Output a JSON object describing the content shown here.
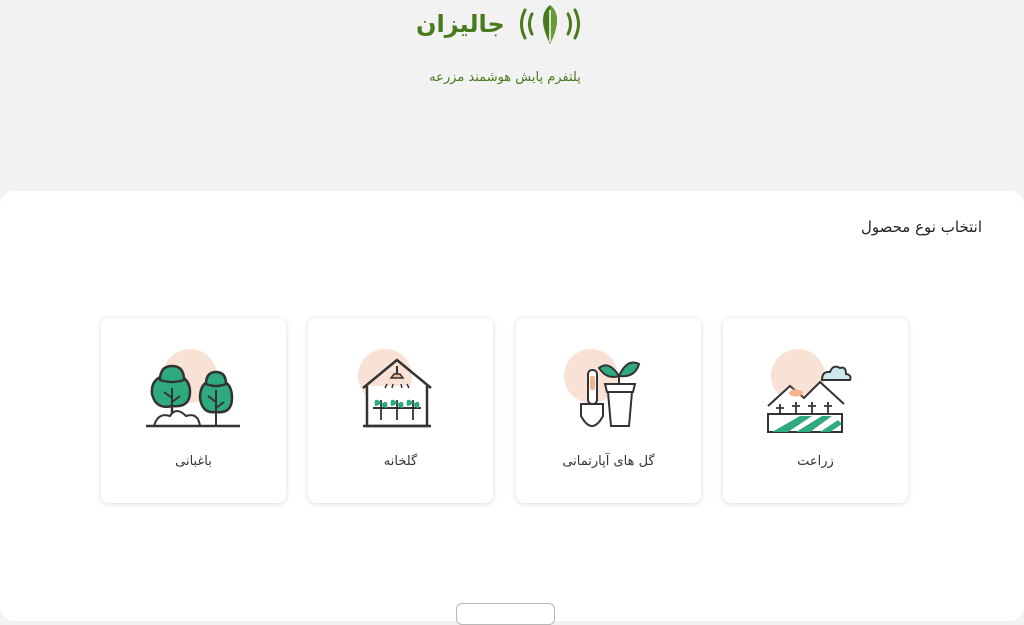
{
  "header": {
    "brand_name": "جالیزان",
    "tagline": "پلتفرم پایش هوشمند مزرعه",
    "logo_icon": "leaf-signal-icon",
    "brand_color": "#4a7a1e"
  },
  "main": {
    "section_title": "انتخاب نوع محصول",
    "cards": [
      {
        "label": "زراعت",
        "icon": "field-farming-icon"
      },
      {
        "label": "گل های آپارتمانی",
        "icon": "potted-plant-icon"
      },
      {
        "label": "گلخانه",
        "icon": "greenhouse-icon"
      },
      {
        "label": "باغبانی",
        "icon": "trees-gardening-icon"
      }
    ]
  },
  "colors": {
    "accent_green": "#2eaa7e",
    "peach_circle": "#f8e2d6",
    "page_background": "#f2f2f3"
  }
}
